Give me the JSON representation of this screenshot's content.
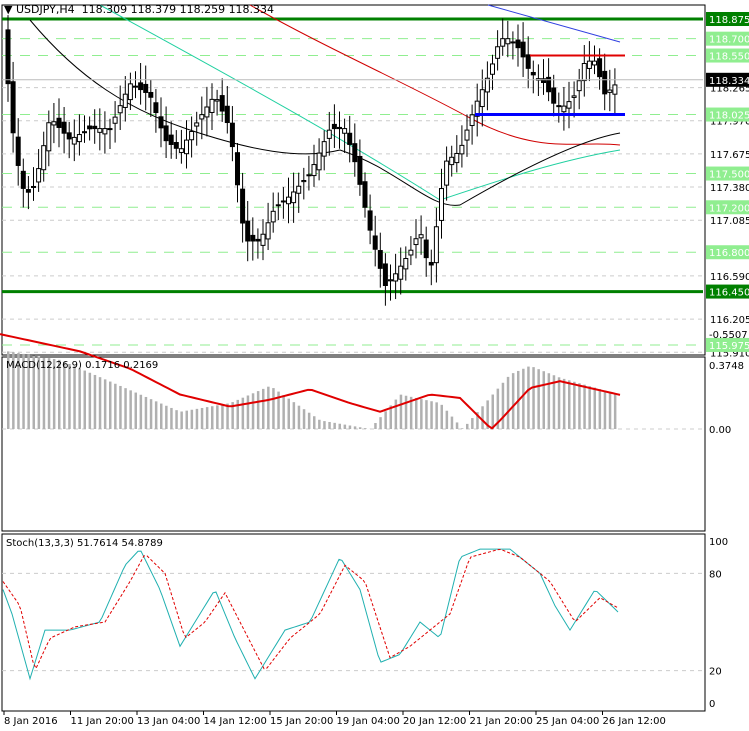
{
  "header": {
    "symbol": "USDJPY,H4",
    "ohlc": "118.309 118.379 118.259 118.334"
  },
  "price_axis": {
    "ticks": [
      "118.265",
      "117.970",
      "117.675",
      "117.380",
      "117.085",
      "116.590",
      "116.205",
      "115.910"
    ],
    "level_labels": [
      {
        "v": "118.875",
        "p": 118.875,
        "style": "solid"
      },
      {
        "v": "118.700",
        "p": 118.7,
        "style": "light"
      },
      {
        "v": "118.550",
        "p": 118.55,
        "style": "light"
      },
      {
        "v": "118.025",
        "p": 118.025,
        "style": "light"
      },
      {
        "v": "117.500",
        "p": 117.5,
        "style": "light"
      },
      {
        "v": "117.200",
        "p": 117.2,
        "style": "light"
      },
      {
        "v": "116.800",
        "p": 116.8,
        "style": "light"
      },
      {
        "v": "116.450",
        "p": 116.45,
        "style": "solid"
      },
      {
        "v": "115.975",
        "p": 115.975,
        "style": "light"
      }
    ],
    "current": "118.334"
  },
  "macd": {
    "label": "MACD(12,26,9) 0.1716 0.2169",
    "max": "0.3748",
    "zero": "0.00",
    "min": "-0.5507"
  },
  "stoch": {
    "label": "Stoch(13,3,3) 51.7614 54.8789",
    "ticks": [
      "100",
      "80",
      "20",
      "0"
    ]
  },
  "time_axis": [
    "8 Jan 2016",
    "11 Jan 20:00",
    "13 Jan 04:00",
    "14 Jan 12:00",
    "15 Jan 20:00",
    "19 Jan 04:00",
    "20 Jan 12:00",
    "21 Jan 20:00",
    "25 Jan 04:00",
    "26 Jan 12:00"
  ],
  "colors": {
    "support": "#0000ff",
    "resistance": "#e00000",
    "level": "#008000",
    "light": "#90ee90"
  },
  "price_path": [
    [
      8,
      118.3
    ],
    [
      15,
      117.7
    ],
    [
      25,
      117.3
    ],
    [
      35,
      117.4
    ],
    [
      50,
      118.0
    ],
    [
      70,
      117.8
    ],
    [
      90,
      117.9
    ],
    [
      110,
      117.9
    ],
    [
      130,
      118.3
    ],
    [
      150,
      118.2
    ],
    [
      165,
      117.8
    ],
    [
      180,
      117.7
    ],
    [
      200,
      118.0
    ],
    [
      215,
      118.2
    ],
    [
      230,
      117.9
    ],
    [
      245,
      116.9
    ],
    [
      260,
      116.9
    ],
    [
      275,
      117.2
    ],
    [
      290,
      117.3
    ],
    [
      310,
      117.5
    ],
    [
      330,
      117.9
    ],
    [
      345,
      117.9
    ],
    [
      355,
      117.6
    ],
    [
      370,
      117.0
    ],
    [
      385,
      116.5
    ],
    [
      395,
      116.6
    ],
    [
      410,
      116.8
    ],
    [
      420,
      117.0
    ],
    [
      430,
      116.6
    ],
    [
      445,
      117.6
    ],
    [
      460,
      117.7
    ],
    [
      475,
      118.1
    ],
    [
      490,
      118.4
    ],
    [
      500,
      118.7
    ],
    [
      510,
      118.7
    ],
    [
      520,
      118.6
    ],
    [
      530,
      118.4
    ],
    [
      545,
      118.3
    ],
    [
      555,
      118.1
    ],
    [
      565,
      118.1
    ],
    [
      575,
      118.2
    ],
    [
      585,
      118.5
    ],
    [
      595,
      118.5
    ],
    [
      605,
      118.2
    ],
    [
      620,
      118.334
    ]
  ],
  "macd_hist": [
    [
      8,
      -0.45
    ],
    [
      60,
      -0.4
    ],
    [
      120,
      -0.25
    ],
    [
      180,
      -0.1
    ],
    [
      230,
      -0.15
    ],
    [
      270,
      -0.25
    ],
    [
      320,
      -0.05
    ],
    [
      370,
      0.0
    ],
    [
      400,
      -0.2
    ],
    [
      440,
      -0.15
    ],
    [
      470,
      0.05
    ],
    [
      510,
      0.32
    ],
    [
      530,
      0.37
    ],
    [
      560,
      0.3
    ],
    [
      620,
      0.2
    ]
  ],
  "macd_signal": [
    [
      0,
      -0.55
    ],
    [
      80,
      -0.45
    ],
    [
      130,
      -0.35
    ],
    [
      180,
      -0.2
    ],
    [
      230,
      -0.13
    ],
    [
      270,
      -0.17
    ],
    [
      310,
      -0.23
    ],
    [
      350,
      -0.15
    ],
    [
      380,
      -0.1
    ],
    [
      430,
      -0.2
    ],
    [
      460,
      -0.18
    ],
    [
      500,
      0.05
    ],
    [
      530,
      0.24
    ],
    [
      560,
      0.28
    ],
    [
      620,
      0.2
    ]
  ],
  "stoch_k": [
    [
      3,
      70
    ],
    [
      12,
      55
    ],
    [
      30,
      15
    ],
    [
      45,
      45
    ],
    [
      70,
      45
    ],
    [
      100,
      50
    ],
    [
      125,
      85
    ],
    [
      140,
      95
    ],
    [
      160,
      70
    ],
    [
      180,
      35
    ],
    [
      200,
      55
    ],
    [
      215,
      70
    ],
    [
      235,
      40
    ],
    [
      255,
      15
    ],
    [
      285,
      45
    ],
    [
      310,
      50
    ],
    [
      340,
      90
    ],
    [
      360,
      70
    ],
    [
      380,
      25
    ],
    [
      400,
      30
    ],
    [
      420,
      50
    ],
    [
      440,
      40
    ],
    [
      460,
      90
    ],
    [
      480,
      95
    ],
    [
      510,
      95
    ],
    [
      540,
      80
    ],
    [
      555,
      60
    ],
    [
      570,
      45
    ],
    [
      595,
      70
    ],
    [
      620,
      55
    ]
  ],
  "stoch_d": [
    [
      3,
      75
    ],
    [
      20,
      60
    ],
    [
      35,
      20
    ],
    [
      50,
      40
    ],
    [
      75,
      47
    ],
    [
      105,
      50
    ],
    [
      130,
      75
    ],
    [
      145,
      92
    ],
    [
      165,
      80
    ],
    [
      185,
      40
    ],
    [
      205,
      50
    ],
    [
      225,
      68
    ],
    [
      240,
      50
    ],
    [
      265,
      20
    ],
    [
      290,
      40
    ],
    [
      320,
      55
    ],
    [
      345,
      85
    ],
    [
      365,
      75
    ],
    [
      390,
      28
    ],
    [
      410,
      35
    ],
    [
      430,
      45
    ],
    [
      450,
      55
    ],
    [
      470,
      90
    ],
    [
      500,
      95
    ],
    [
      520,
      90
    ],
    [
      550,
      75
    ],
    [
      575,
      50
    ],
    [
      600,
      65
    ],
    [
      620,
      58
    ]
  ]
}
